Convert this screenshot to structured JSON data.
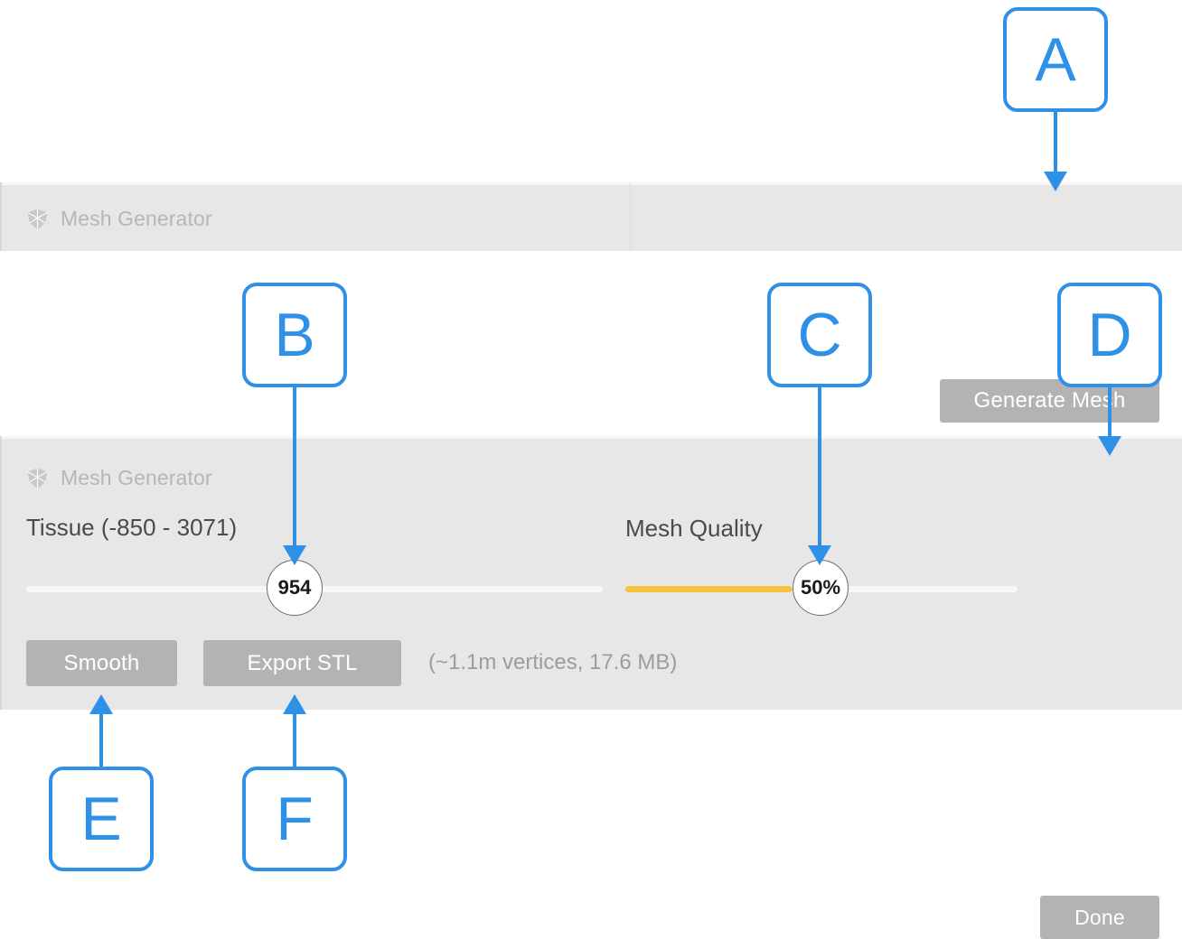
{
  "app": {
    "panel_title": "Mesh Generator",
    "icon": "mesh-cube-icon"
  },
  "colors": {
    "accent_blue": "#2f90e8",
    "panel_bg": "#e7e7e7",
    "button_gray": "#b3b3b3",
    "slider_fill_amber": "#f5c33f",
    "slider_track": "#f7f7f7",
    "label_text": "#4a4a4a",
    "muted_text": "#b6b6b6"
  },
  "panel_one": {
    "title": "Mesh Generator",
    "generate_button": "Generate Mesh"
  },
  "panel_two": {
    "title": "Mesh Generator",
    "done_button": "Done",
    "tissue": {
      "label": "Tissue (-850 - 3071)",
      "value": "954",
      "range_min": -850,
      "range_max": 3071,
      "handle_percent": 45
    },
    "quality": {
      "label": "Mesh Quality",
      "value": "50%",
      "percent": 50
    },
    "smooth_button": "Smooth",
    "export_button": "Export STL",
    "mesh_stats": "(~1.1m vertices, 17.6 MB)"
  },
  "callouts": [
    {
      "id": "A",
      "label": "A",
      "target": "generate-mesh-button"
    },
    {
      "id": "B",
      "label": "B",
      "target": "tissue-slider-handle"
    },
    {
      "id": "C",
      "label": "C",
      "target": "quality-slider-handle"
    },
    {
      "id": "D",
      "label": "D",
      "target": "done-button"
    },
    {
      "id": "E",
      "label": "E",
      "target": "smooth-button"
    },
    {
      "id": "F",
      "label": "F",
      "target": "export-stl-button"
    }
  ]
}
